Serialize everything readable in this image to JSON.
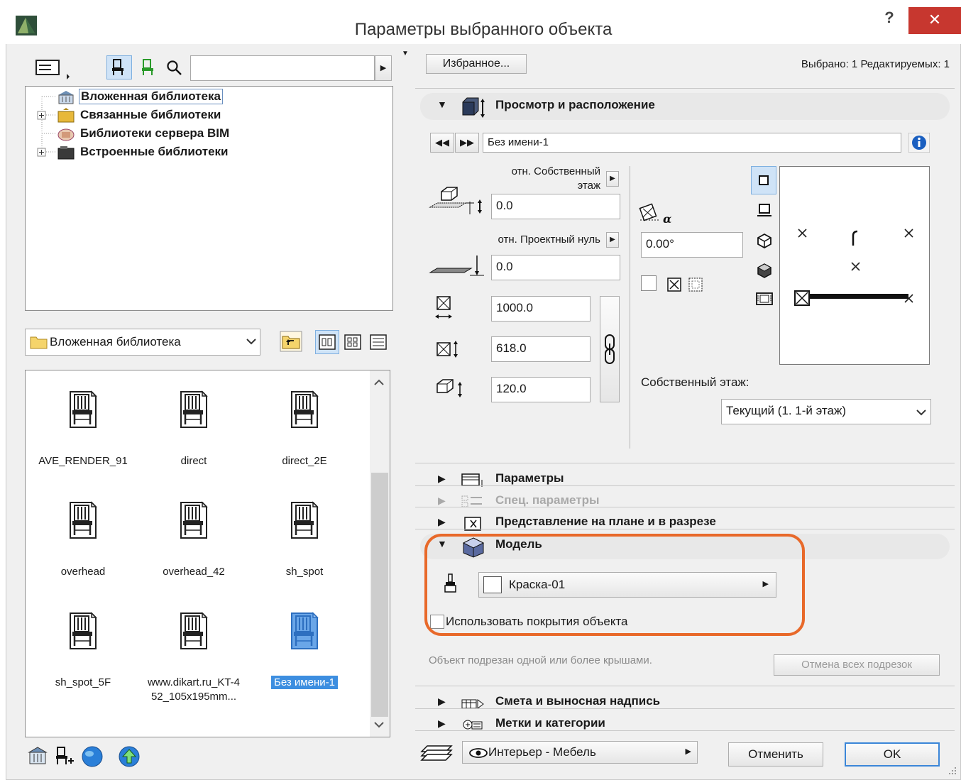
{
  "window": {
    "title": "Параметры выбранного объекта",
    "help": "?",
    "close": "✕"
  },
  "library": {
    "search_value": "",
    "tree": [
      {
        "label": "Вложенная библиотека",
        "selected": true
      },
      {
        "label": "Связанные библиотеки"
      },
      {
        "label": "Библиотеки сервера BIM"
      },
      {
        "label": "Встроенные библиотеки"
      }
    ],
    "folder_select": "Вложенная библиотека",
    "items": [
      {
        "label": "AVE_RENDER_91"
      },
      {
        "label": "direct"
      },
      {
        "label": "direct_2E"
      },
      {
        "label": "overhead"
      },
      {
        "label": "overhead_42"
      },
      {
        "label": "sh_spot"
      },
      {
        "label": "sh_spot_5F"
      },
      {
        "label": "www.dikart.ru_KT-4",
        "label2": "52_105x195mm..."
      },
      {
        "label": "Без имени-1",
        "selected": true
      }
    ]
  },
  "header": {
    "favorites_button": "Избранное...",
    "selection_info": "Выбрано: 1 Редактируемых: 1"
  },
  "view_section": {
    "title": "Просмотр и расположение",
    "object_name": "Без имени-1",
    "rel_story_label_1": "отн. Собственный",
    "rel_story_label_2": "этаж",
    "elev_story": "0.0",
    "rel_zero_label": "отн. Проектный нуль",
    "elev_zero": "0.0",
    "width": "1000.0",
    "depth": "618.0",
    "height": "120.0",
    "angle": "0.00°",
    "home_story_label": "Собственный этаж:",
    "home_story_value": "Текущий (1. 1-й этаж)"
  },
  "sections": {
    "params": "Параметры",
    "special": "Спец. параметры",
    "plan": "Представление на плане и в разрезе",
    "model": "Модель",
    "estimate": "Смета и выносная надпись",
    "tags": "Метки и категории"
  },
  "model_section": {
    "surface": "Краска-01",
    "use_object_surfaces": "Использовать покрытия объекта"
  },
  "trim": {
    "info": "Объект подрезан одной или более крышами.",
    "cancel_button": "Отмена всех подрезок"
  },
  "footer": {
    "layer": "Интерьер - Мебель",
    "cancel": "Отменить",
    "ok": "OK"
  },
  "colors": {
    "highlight": "#e8692a",
    "selection": "#3d8ee0"
  }
}
